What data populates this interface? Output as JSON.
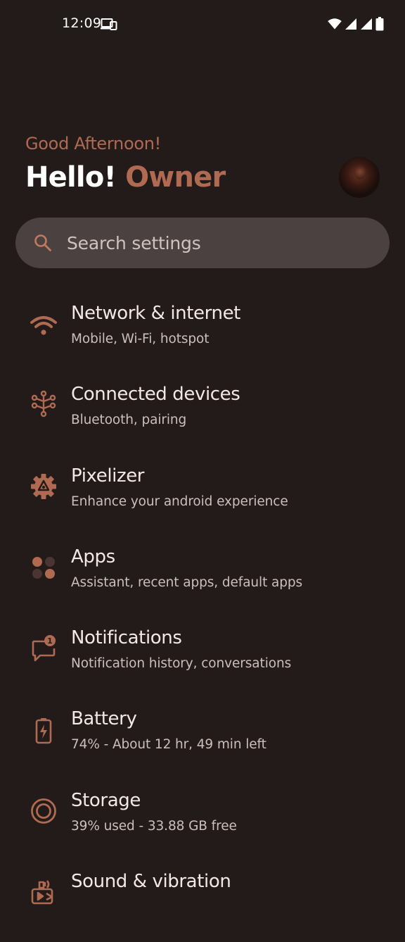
{
  "status_bar": {
    "time": "12:09",
    "left_icons": [
      "screen-cast-icon"
    ],
    "right_icons": [
      "wifi-icon",
      "cell-signal-icon",
      "cell-signal-icon",
      "battery-icon"
    ]
  },
  "header": {
    "greeting": "Good Afternoon!",
    "hello": "Hello!",
    "name": "Owner",
    "accent_color": "#b06a52"
  },
  "search": {
    "placeholder": "Search settings",
    "icon": "search-icon"
  },
  "settings": [
    {
      "icon": "wifi-icon",
      "title": "Network & internet",
      "subtitle": "Mobile, Wi-Fi, hotspot"
    },
    {
      "icon": "connected-devices-icon",
      "title": "Connected devices",
      "subtitle": "Bluetooth, pairing"
    },
    {
      "icon": "pixelizer-gear-icon",
      "title": "Pixelizer",
      "subtitle": "Enhance your android experience"
    },
    {
      "icon": "apps-grid-icon",
      "title": "Apps",
      "subtitle": "Assistant, recent apps, default apps"
    },
    {
      "icon": "notifications-icon",
      "title": "Notifications",
      "subtitle": "Notification history, conversations"
    },
    {
      "icon": "battery-icon",
      "title": "Battery",
      "subtitle": "74% - About 12 hr, 49 min left"
    },
    {
      "icon": "storage-icon",
      "title": "Storage",
      "subtitle": "39% used - 33.88 GB free"
    },
    {
      "icon": "sound-icon",
      "title": "Sound & vibration",
      "subtitle": ""
    }
  ],
  "colors": {
    "background": "#221b1a",
    "search_bg": "#4b4140",
    "icon_accent": "#b06a52"
  }
}
